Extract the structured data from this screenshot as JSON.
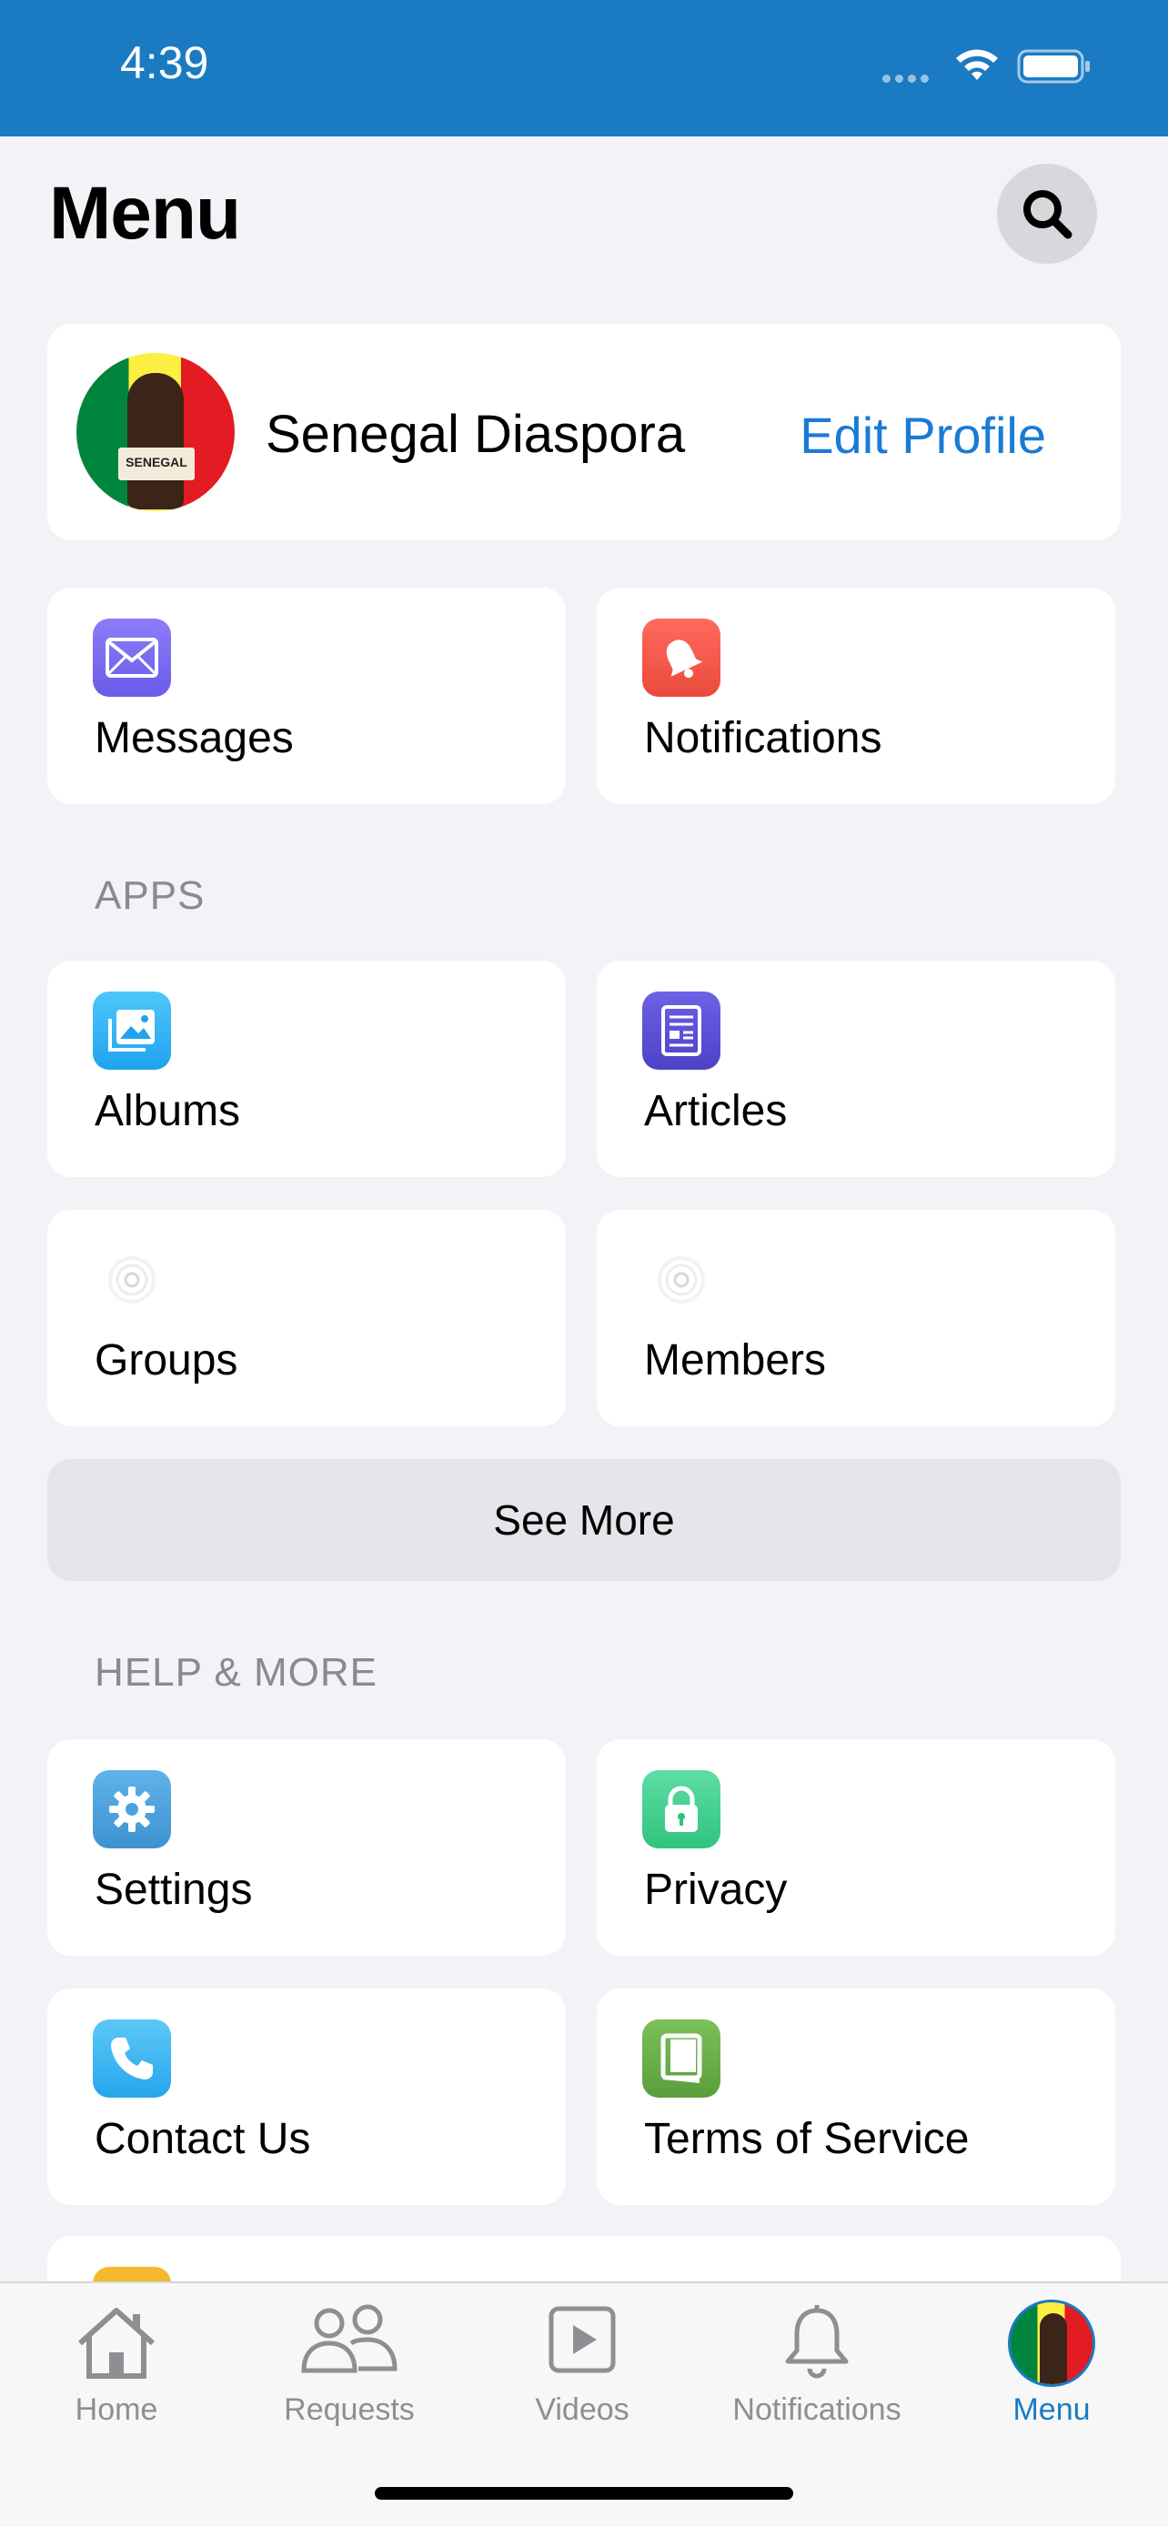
{
  "status_bar": {
    "time": "4:39"
  },
  "header": {
    "title": "Menu"
  },
  "profile": {
    "name": "Senegal Diaspora",
    "edit_label": "Edit Profile",
    "avatar_sign_text": "SENEGAL"
  },
  "quick_actions": [
    {
      "label": "Messages",
      "icon": "envelope-icon",
      "color": "#7b6cf6"
    },
    {
      "label": "Notifications",
      "icon": "bell-icon",
      "color": "#f2594b"
    }
  ],
  "apps": {
    "header": "APPS",
    "items": [
      {
        "label": "Albums",
        "icon": "photo-album-icon",
        "color": "#2fb4f5"
      },
      {
        "label": "Articles",
        "icon": "newspaper-icon",
        "color": "#5b4fd6"
      },
      {
        "label": "Groups",
        "icon": "loading-placeholder-icon",
        "color": "#e5e5ea"
      },
      {
        "label": "Members",
        "icon": "loading-placeholder-icon",
        "color": "#e5e5ea"
      }
    ],
    "see_more_label": "See More"
  },
  "help_more": {
    "header": "HELP & MORE",
    "items": [
      {
        "label": "Settings",
        "icon": "gear-icon",
        "color": "#4aa3e0"
      },
      {
        "label": "Privacy",
        "icon": "lock-icon",
        "color": "#3dcf8e"
      },
      {
        "label": "Contact Us",
        "icon": "phone-icon",
        "color": "#38b5f0"
      },
      {
        "label": "Terms of Service",
        "icon": "book-icon",
        "color": "#6ab04c"
      }
    ]
  },
  "tab_bar": {
    "tabs": [
      {
        "label": "Home",
        "icon": "home-icon",
        "active": false
      },
      {
        "label": "Requests",
        "icon": "people-icon",
        "active": false
      },
      {
        "label": "Videos",
        "icon": "video-play-icon",
        "active": false
      },
      {
        "label": "Notifications",
        "icon": "bell-outline-icon",
        "active": false
      },
      {
        "label": "Menu",
        "icon": "avatar",
        "active": true
      }
    ],
    "active_color": "#1a7bc2",
    "inactive_color": "#8e8e93"
  },
  "colors": {
    "brand_blue": "#1a7bc2",
    "link_blue": "#1a7bd6"
  }
}
